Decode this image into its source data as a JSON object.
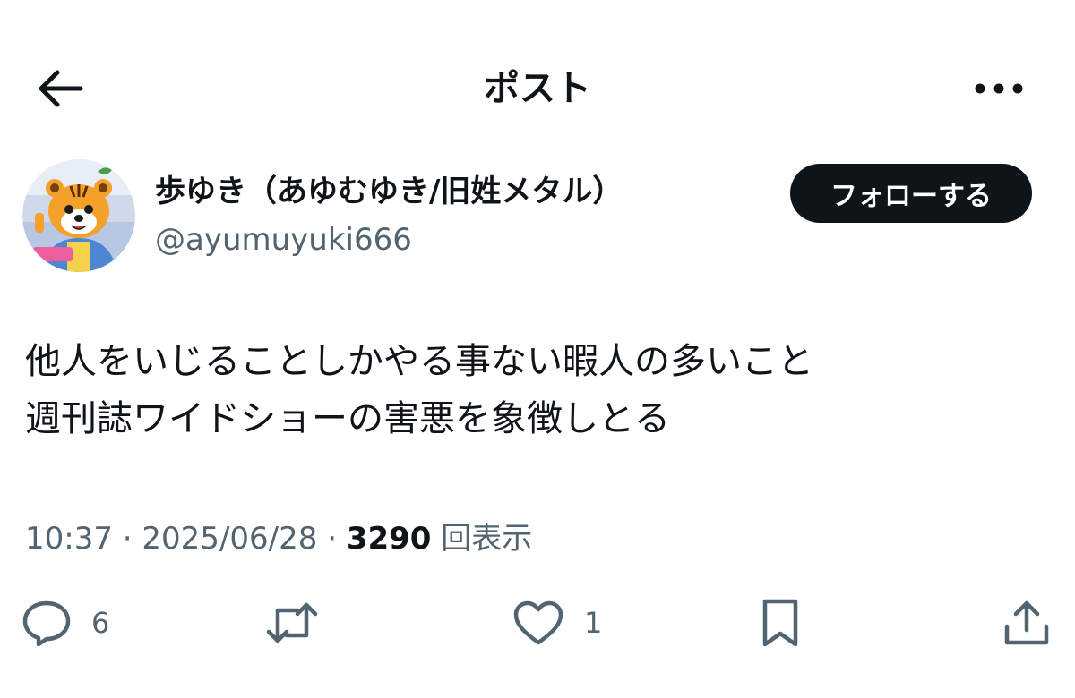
{
  "header": {
    "title": "ポスト",
    "back_icon": "arrow-left-icon",
    "more_icon": "more-horizontal-icon"
  },
  "author": {
    "display_name": "歩ゆき（あゆむゆき/旧姓メタル）",
    "handle": "@ayumuyuki666",
    "avatar_icon": "tiger-character-avatar",
    "follow_label": "フォローする"
  },
  "post": {
    "lines": [
      "他人をいじることしかやる事ない暇人の多いこと",
      "週刊誌ワイドショーの害悪を象徴しとる"
    ]
  },
  "meta": {
    "time": "10:37",
    "separator": " · ",
    "date": "2025/06/28",
    "views": "3290",
    "views_label": " 回表示"
  },
  "actions": {
    "reply": {
      "icon": "reply-icon",
      "count": "6"
    },
    "repost": {
      "icon": "repost-icon",
      "count": ""
    },
    "like": {
      "icon": "heart-icon",
      "count": "1"
    },
    "bookmark": {
      "icon": "bookmark-icon"
    },
    "share": {
      "icon": "share-icon"
    }
  },
  "colors": {
    "text": "#0f1419",
    "secondary": "#536471",
    "follow_bg": "#0f1419",
    "follow_text": "#ffffff"
  }
}
